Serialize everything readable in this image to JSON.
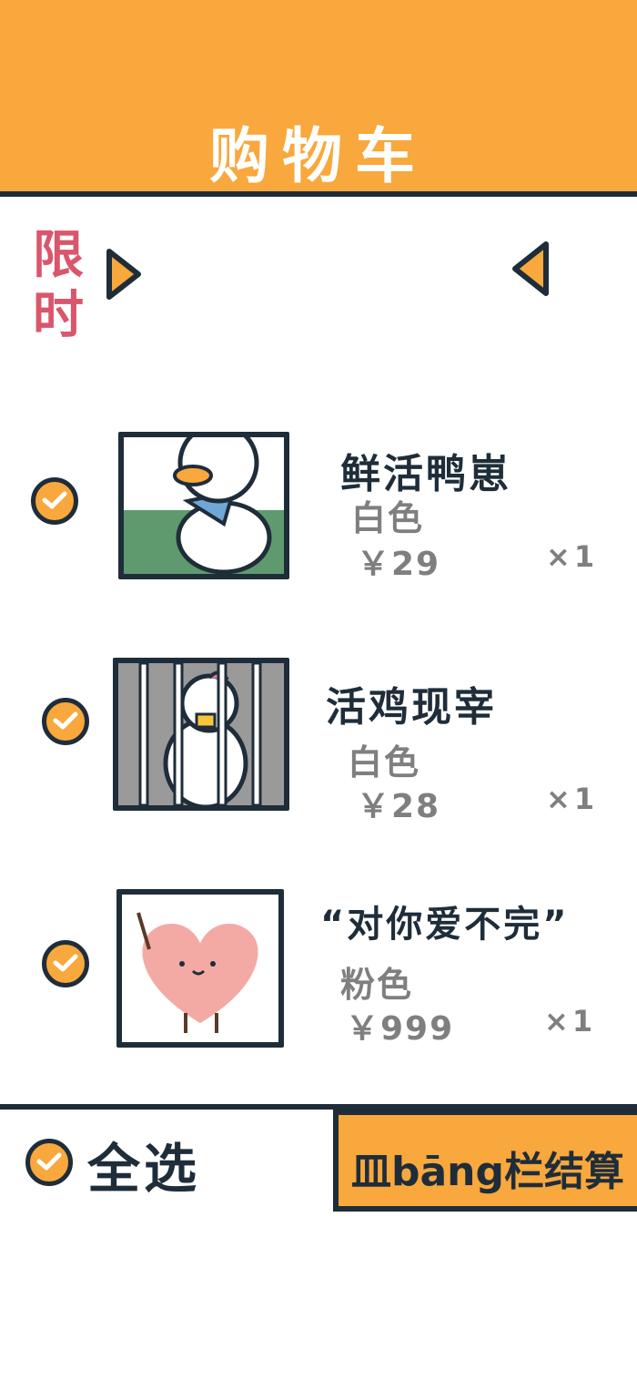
{
  "header": {
    "title": "购物车"
  },
  "promo": {
    "label": "限时"
  },
  "items": [
    {
      "name": "鲜活鸭崽",
      "variant": "白色",
      "price": "￥29",
      "qty": "×1",
      "checked": true,
      "icon": "duck-illustration"
    },
    {
      "name": "活鸡现宰",
      "variant": "白色",
      "price": "￥28",
      "qty": "×1",
      "checked": true,
      "icon": "caged-chicken-illustration"
    },
    {
      "name": "“对你爱不完”",
      "variant": "粉色",
      "price": "￥999",
      "qty": "×1",
      "checked": true,
      "icon": "heart-illustration"
    }
  ],
  "footer": {
    "select_all_label": "全选",
    "checkout_label": "皿bāng栏结算"
  },
  "colors": {
    "accent": "#f8a83c",
    "outline": "#1f2d3a",
    "promo": "#d9566c",
    "muted": "#7f7f7f"
  }
}
